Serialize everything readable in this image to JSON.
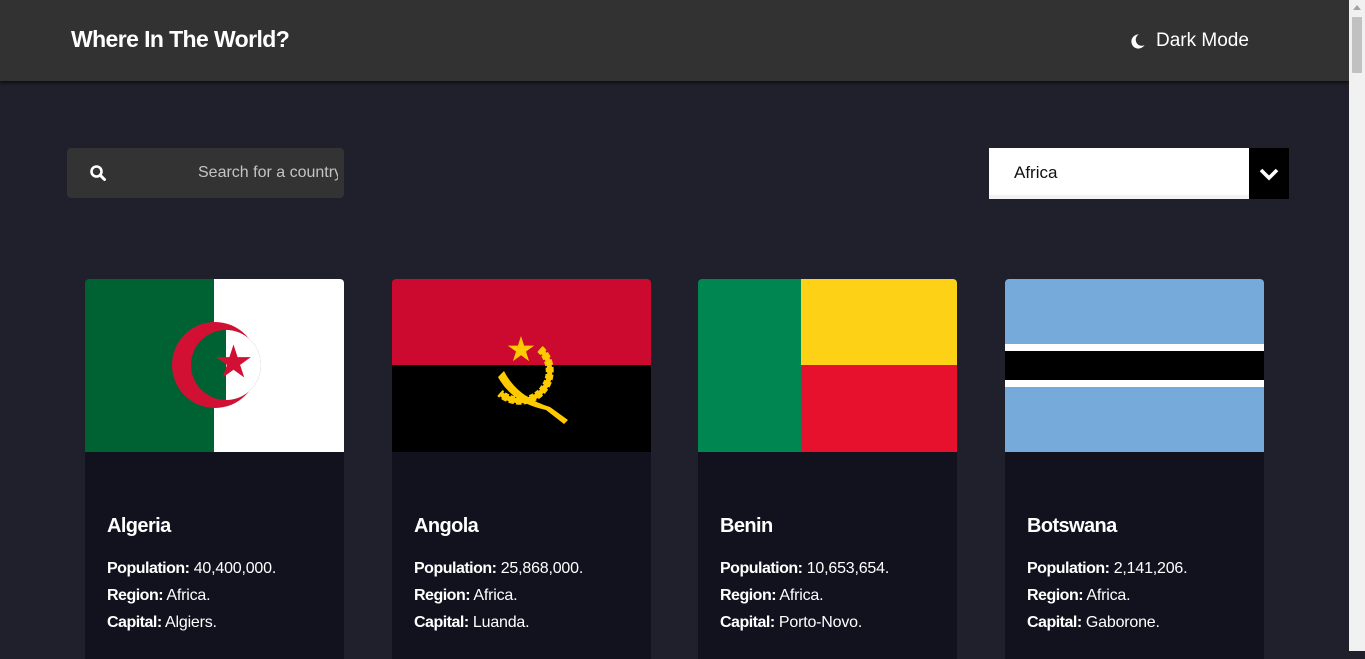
{
  "header": {
    "title": "Where In The World?",
    "mode_toggle": {
      "icon": "moon-icon",
      "label": "Dark Mode"
    }
  },
  "search": {
    "icon": "search-icon",
    "placeholder": "Search for a country..",
    "value": ""
  },
  "region_filter": {
    "selected": "Africa",
    "icon": "chevron-down-icon"
  },
  "labels": {
    "population": "Population:",
    "region": "Region:",
    "capital": "Capital:"
  },
  "countries": [
    {
      "name": "Algeria",
      "population": "40,400,000.",
      "region": "Africa.",
      "capital": "Algiers."
    },
    {
      "name": "Angola",
      "population": "25,868,000.",
      "region": "Africa.",
      "capital": "Luanda."
    },
    {
      "name": "Benin",
      "population": "10,653,654.",
      "region": "Africa.",
      "capital": "Porto-Novo."
    },
    {
      "name": "Botswana",
      "population": "2,141,206.",
      "region": "Africa.",
      "capital": "Gaborone."
    }
  ],
  "colors": {
    "background": "#1f202b",
    "header": "#323232",
    "card": "#12121f",
    "text": "#ffffff"
  }
}
